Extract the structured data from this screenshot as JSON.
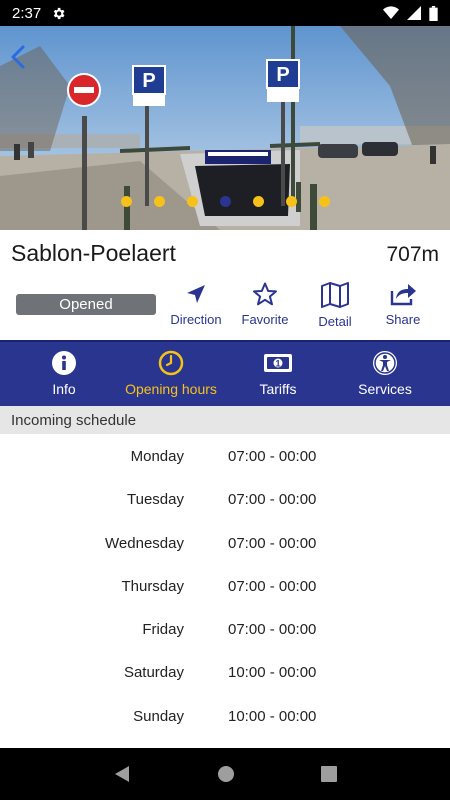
{
  "status_bar": {
    "time": "2:37"
  },
  "hero": {
    "sign_letter": "P",
    "carousel_count": 7,
    "carousel_active_index": 3
  },
  "parking": {
    "name": "Sablon-Poelaert",
    "distance": "707m",
    "status": "Opened"
  },
  "actions": [
    {
      "id": "direction",
      "label": "Direction",
      "icon": "navigation-arrow-icon"
    },
    {
      "id": "favorite",
      "label": "Favorite",
      "icon": "star-icon"
    },
    {
      "id": "detail",
      "label": "Detail",
      "icon": "map-icon"
    },
    {
      "id": "share",
      "label": "Share",
      "icon": "share-icon"
    }
  ],
  "tabs": [
    {
      "id": "info",
      "label": "Info",
      "icon": "info-icon",
      "active": false
    },
    {
      "id": "hours",
      "label": "Opening hours",
      "icon": "clock-icon",
      "active": true
    },
    {
      "id": "tariffs",
      "label": "Tariffs",
      "icon": "banknote-icon",
      "active": false
    },
    {
      "id": "services",
      "label": "Services",
      "icon": "accessibility-icon",
      "active": false
    }
  ],
  "schedule": {
    "header": "Incoming schedule",
    "rows": [
      {
        "day": "Monday",
        "hours": "07:00 - 00:00"
      },
      {
        "day": "Tuesday",
        "hours": "07:00 - 00:00"
      },
      {
        "day": "Wednesday",
        "hours": "07:00 - 00:00"
      },
      {
        "day": "Thursday",
        "hours": "07:00 - 00:00"
      },
      {
        "day": "Friday",
        "hours": "07:00 - 00:00"
      },
      {
        "day": "Saturday",
        "hours": "10:00 - 00:00"
      },
      {
        "day": "Sunday",
        "hours": "10:00 - 00:00"
      }
    ]
  },
  "colors": {
    "brand_blue": "#2a3590",
    "accent_yellow": "#f6c21a",
    "status_grey": "#6f7377"
  }
}
